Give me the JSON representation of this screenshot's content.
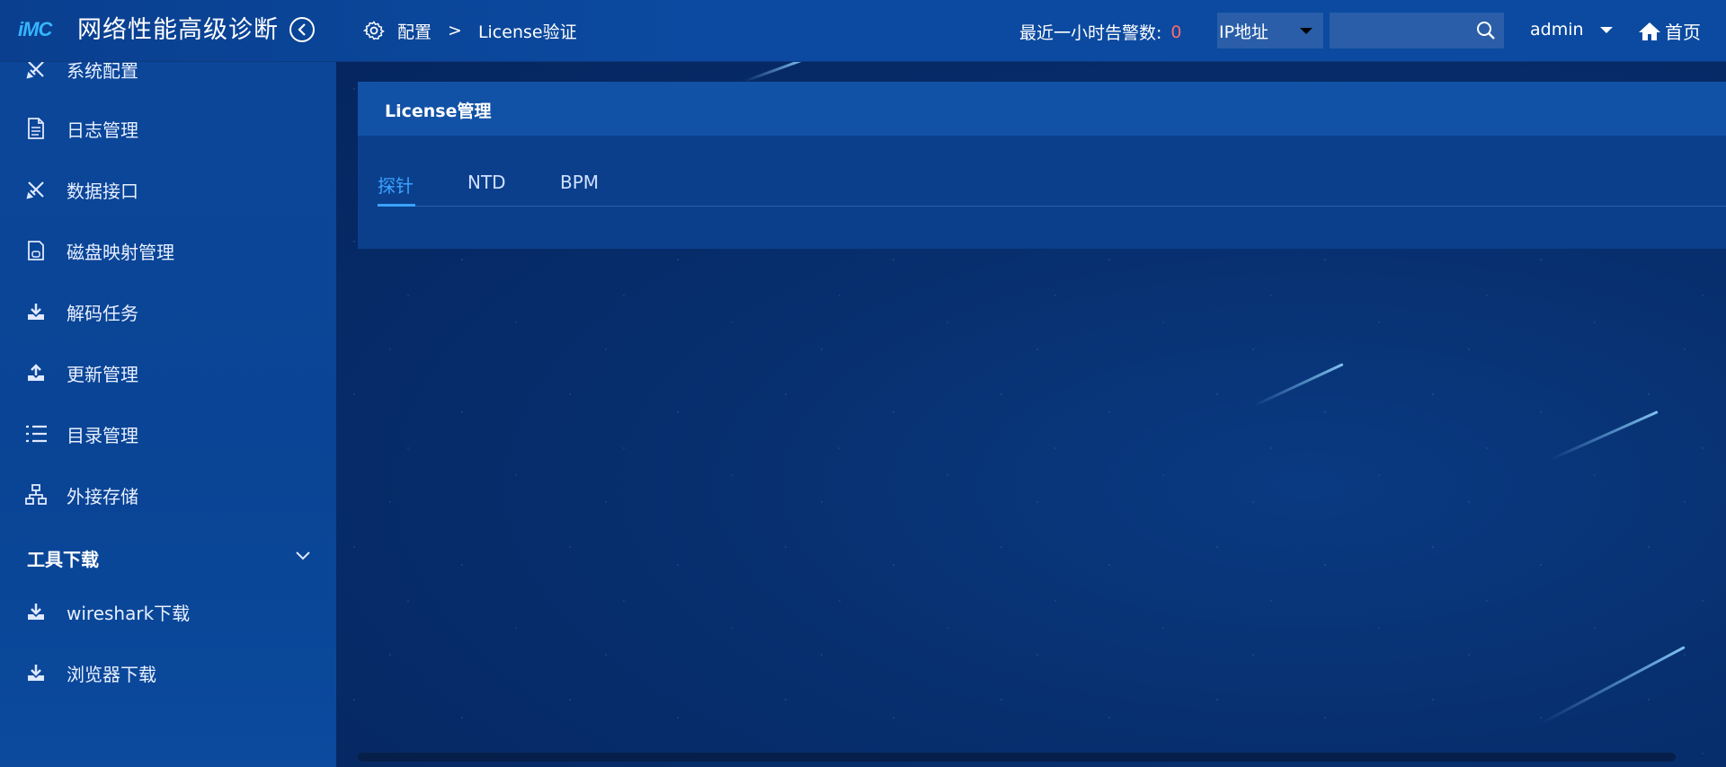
{
  "header": {
    "logo_text": "iMC",
    "app_title": "网络性能高级诊断",
    "breadcrumb": [
      "配置",
      "License验证"
    ],
    "breadcrumb_sep": ">",
    "alarm_label": "最近一小时告警数:",
    "alarm_count": "0",
    "ip_select_value": "IP地址",
    "search_placeholder": "",
    "user": "admin",
    "home_label": "首页"
  },
  "sidebar": {
    "items": [
      {
        "label": "系统配置",
        "icon": "tools-icon"
      },
      {
        "label": "日志管理",
        "icon": "document-icon"
      },
      {
        "label": "数据接口",
        "icon": "tools-icon"
      },
      {
        "label": "磁盘映射管理",
        "icon": "sd-card-icon"
      },
      {
        "label": "解码任务",
        "icon": "download-icon"
      },
      {
        "label": "更新管理",
        "icon": "upload-icon"
      },
      {
        "label": "目录管理",
        "icon": "list-icon"
      },
      {
        "label": "外接存储",
        "icon": "network-icon"
      }
    ],
    "group": {
      "label": "工具下载",
      "expanded": true
    },
    "group_items": [
      {
        "label": "wireshark下载",
        "icon": "download-icon"
      },
      {
        "label": "浏览器下载",
        "icon": "download-icon"
      }
    ]
  },
  "main": {
    "card_title": "License管理",
    "tabs": [
      {
        "label": "探针",
        "active": true
      },
      {
        "label": "NTD",
        "active": false
      },
      {
        "label": "BPM",
        "active": false
      }
    ]
  },
  "colors": {
    "accent": "#3aa3ff",
    "alarm": "#ff6b6b",
    "header_bg": "#0b4aa0",
    "sidebar_bg": "#0a4495",
    "main_bg": "#072f6e"
  }
}
